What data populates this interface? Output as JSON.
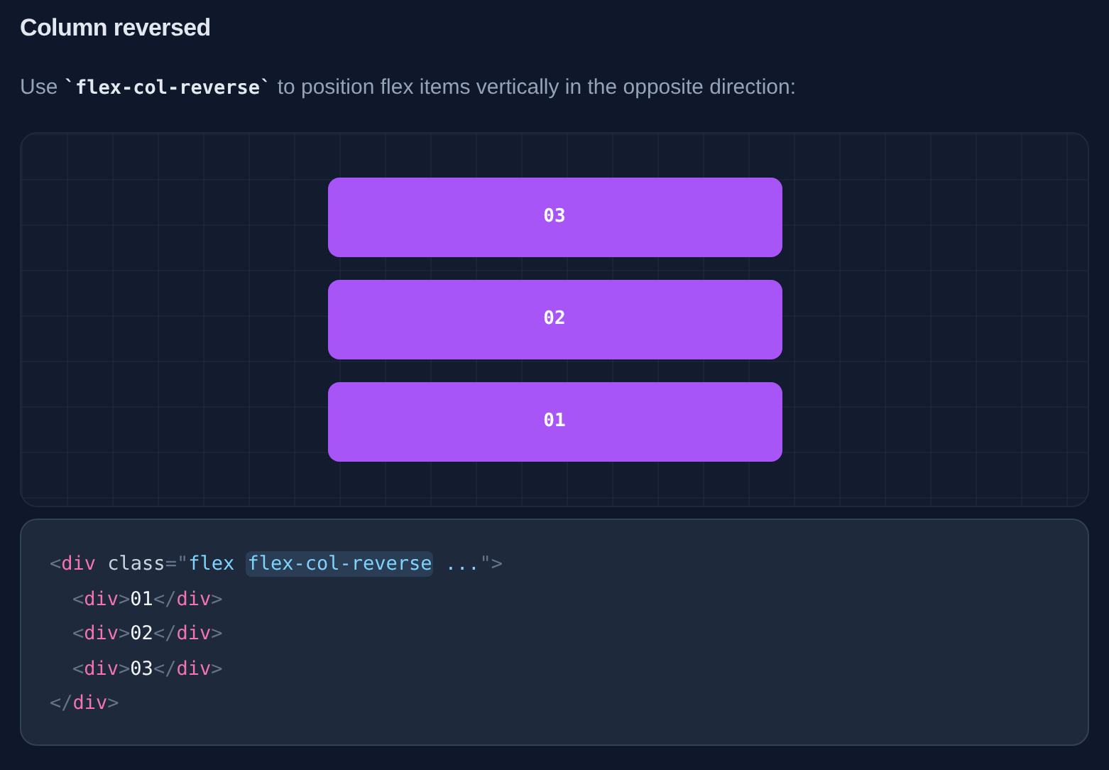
{
  "heading": "Column reversed",
  "description": {
    "before": "Use ",
    "code": "`flex-col-reverse`",
    "after": " to position flex items vertically in the opposite direction:"
  },
  "preview": {
    "items": [
      "03",
      "02",
      "01"
    ]
  },
  "code": [
    {
      "tokens": [
        {
          "kind": "punct",
          "text": "<"
        },
        {
          "kind": "tag",
          "text": "div"
        },
        {
          "kind": "attr",
          "text": " class"
        },
        {
          "kind": "punct",
          "text": "=\""
        },
        {
          "kind": "string",
          "text": "flex "
        },
        {
          "kind": "highlight",
          "text": "flex-col-reverse"
        },
        {
          "kind": "string",
          "text": " ..."
        },
        {
          "kind": "punct",
          "text": "\">"
        }
      ],
      "children": [
        {
          "tokens": [
            {
              "kind": "punct",
              "text": "<"
            },
            {
              "kind": "tag",
              "text": "div"
            },
            {
              "kind": "punct",
              "text": ">"
            },
            {
              "kind": "text",
              "text": "01"
            },
            {
              "kind": "punct",
              "text": "</"
            },
            {
              "kind": "tag",
              "text": "div"
            },
            {
              "kind": "punct",
              "text": ">"
            }
          ]
        },
        {
          "tokens": [
            {
              "kind": "punct",
              "text": "<"
            },
            {
              "kind": "tag",
              "text": "div"
            },
            {
              "kind": "punct",
              "text": ">"
            },
            {
              "kind": "text",
              "text": "02"
            },
            {
              "kind": "punct",
              "text": "</"
            },
            {
              "kind": "tag",
              "text": "div"
            },
            {
              "kind": "punct",
              "text": ">"
            }
          ]
        },
        {
          "tokens": [
            {
              "kind": "punct",
              "text": "<"
            },
            {
              "kind": "tag",
              "text": "div"
            },
            {
              "kind": "punct",
              "text": ">"
            },
            {
              "kind": "text",
              "text": "03"
            },
            {
              "kind": "punct",
              "text": "</"
            },
            {
              "kind": "tag",
              "text": "div"
            },
            {
              "kind": "punct",
              "text": ">"
            }
          ]
        }
      ]
    },
    {
      "tokens": [
        {
          "kind": "punct",
          "text": "</"
        },
        {
          "kind": "tag",
          "text": "div"
        },
        {
          "kind": "punct",
          "text": ">"
        }
      ]
    }
  ]
}
